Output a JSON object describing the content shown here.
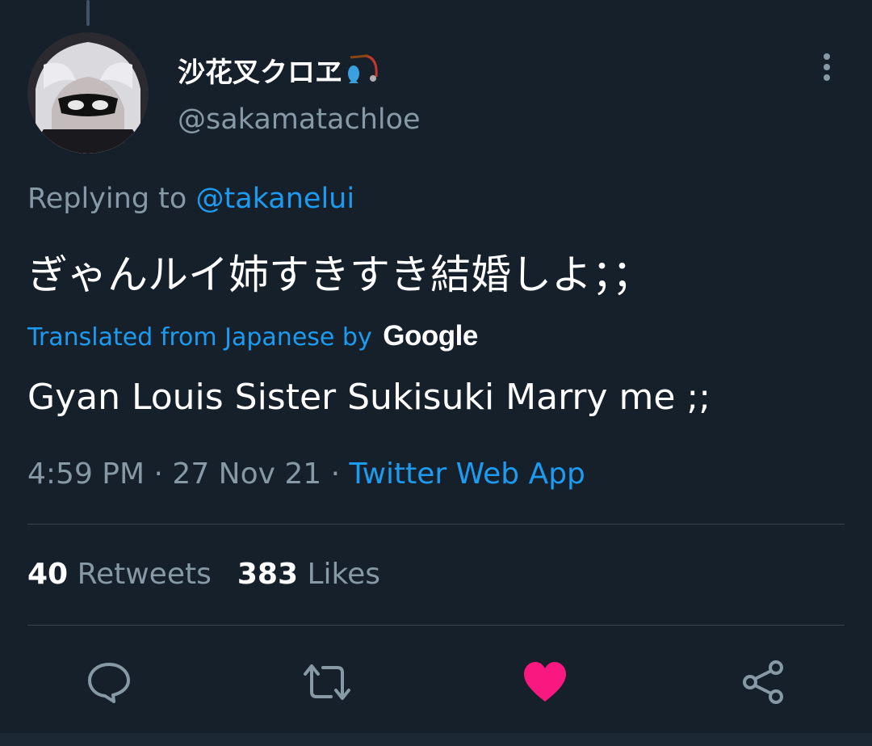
{
  "author": {
    "display_name": "沙花叉クロヱ",
    "handle": "@sakamatachloe"
  },
  "reply": {
    "prefix": "Replying to",
    "mention": "@takanelui"
  },
  "tweet": {
    "text": "ぎゃんルイ姉すきすき結婚しよ；；",
    "translated_label": "Translated from Japanese by",
    "translated_brand": "Google",
    "translation": "Gyan Louis Sister Sukisuki Marry me ;;",
    "time": "4:59 PM",
    "date": "27 Nov 21",
    "source": "Twitter Web App",
    "separator": "·"
  },
  "stats": {
    "retweets_count": "40",
    "retweets_label": "Retweets",
    "likes_count": "383",
    "likes_label": "Likes"
  },
  "colors": {
    "background": "#15202b",
    "accent": "#1d9bf0",
    "like": "#f91880",
    "muted": "#8899a6"
  },
  "icons": [
    "reply-icon",
    "retweet-icon",
    "like-icon",
    "share-icon",
    "more-icon",
    "fishing-rod-emoji"
  ]
}
